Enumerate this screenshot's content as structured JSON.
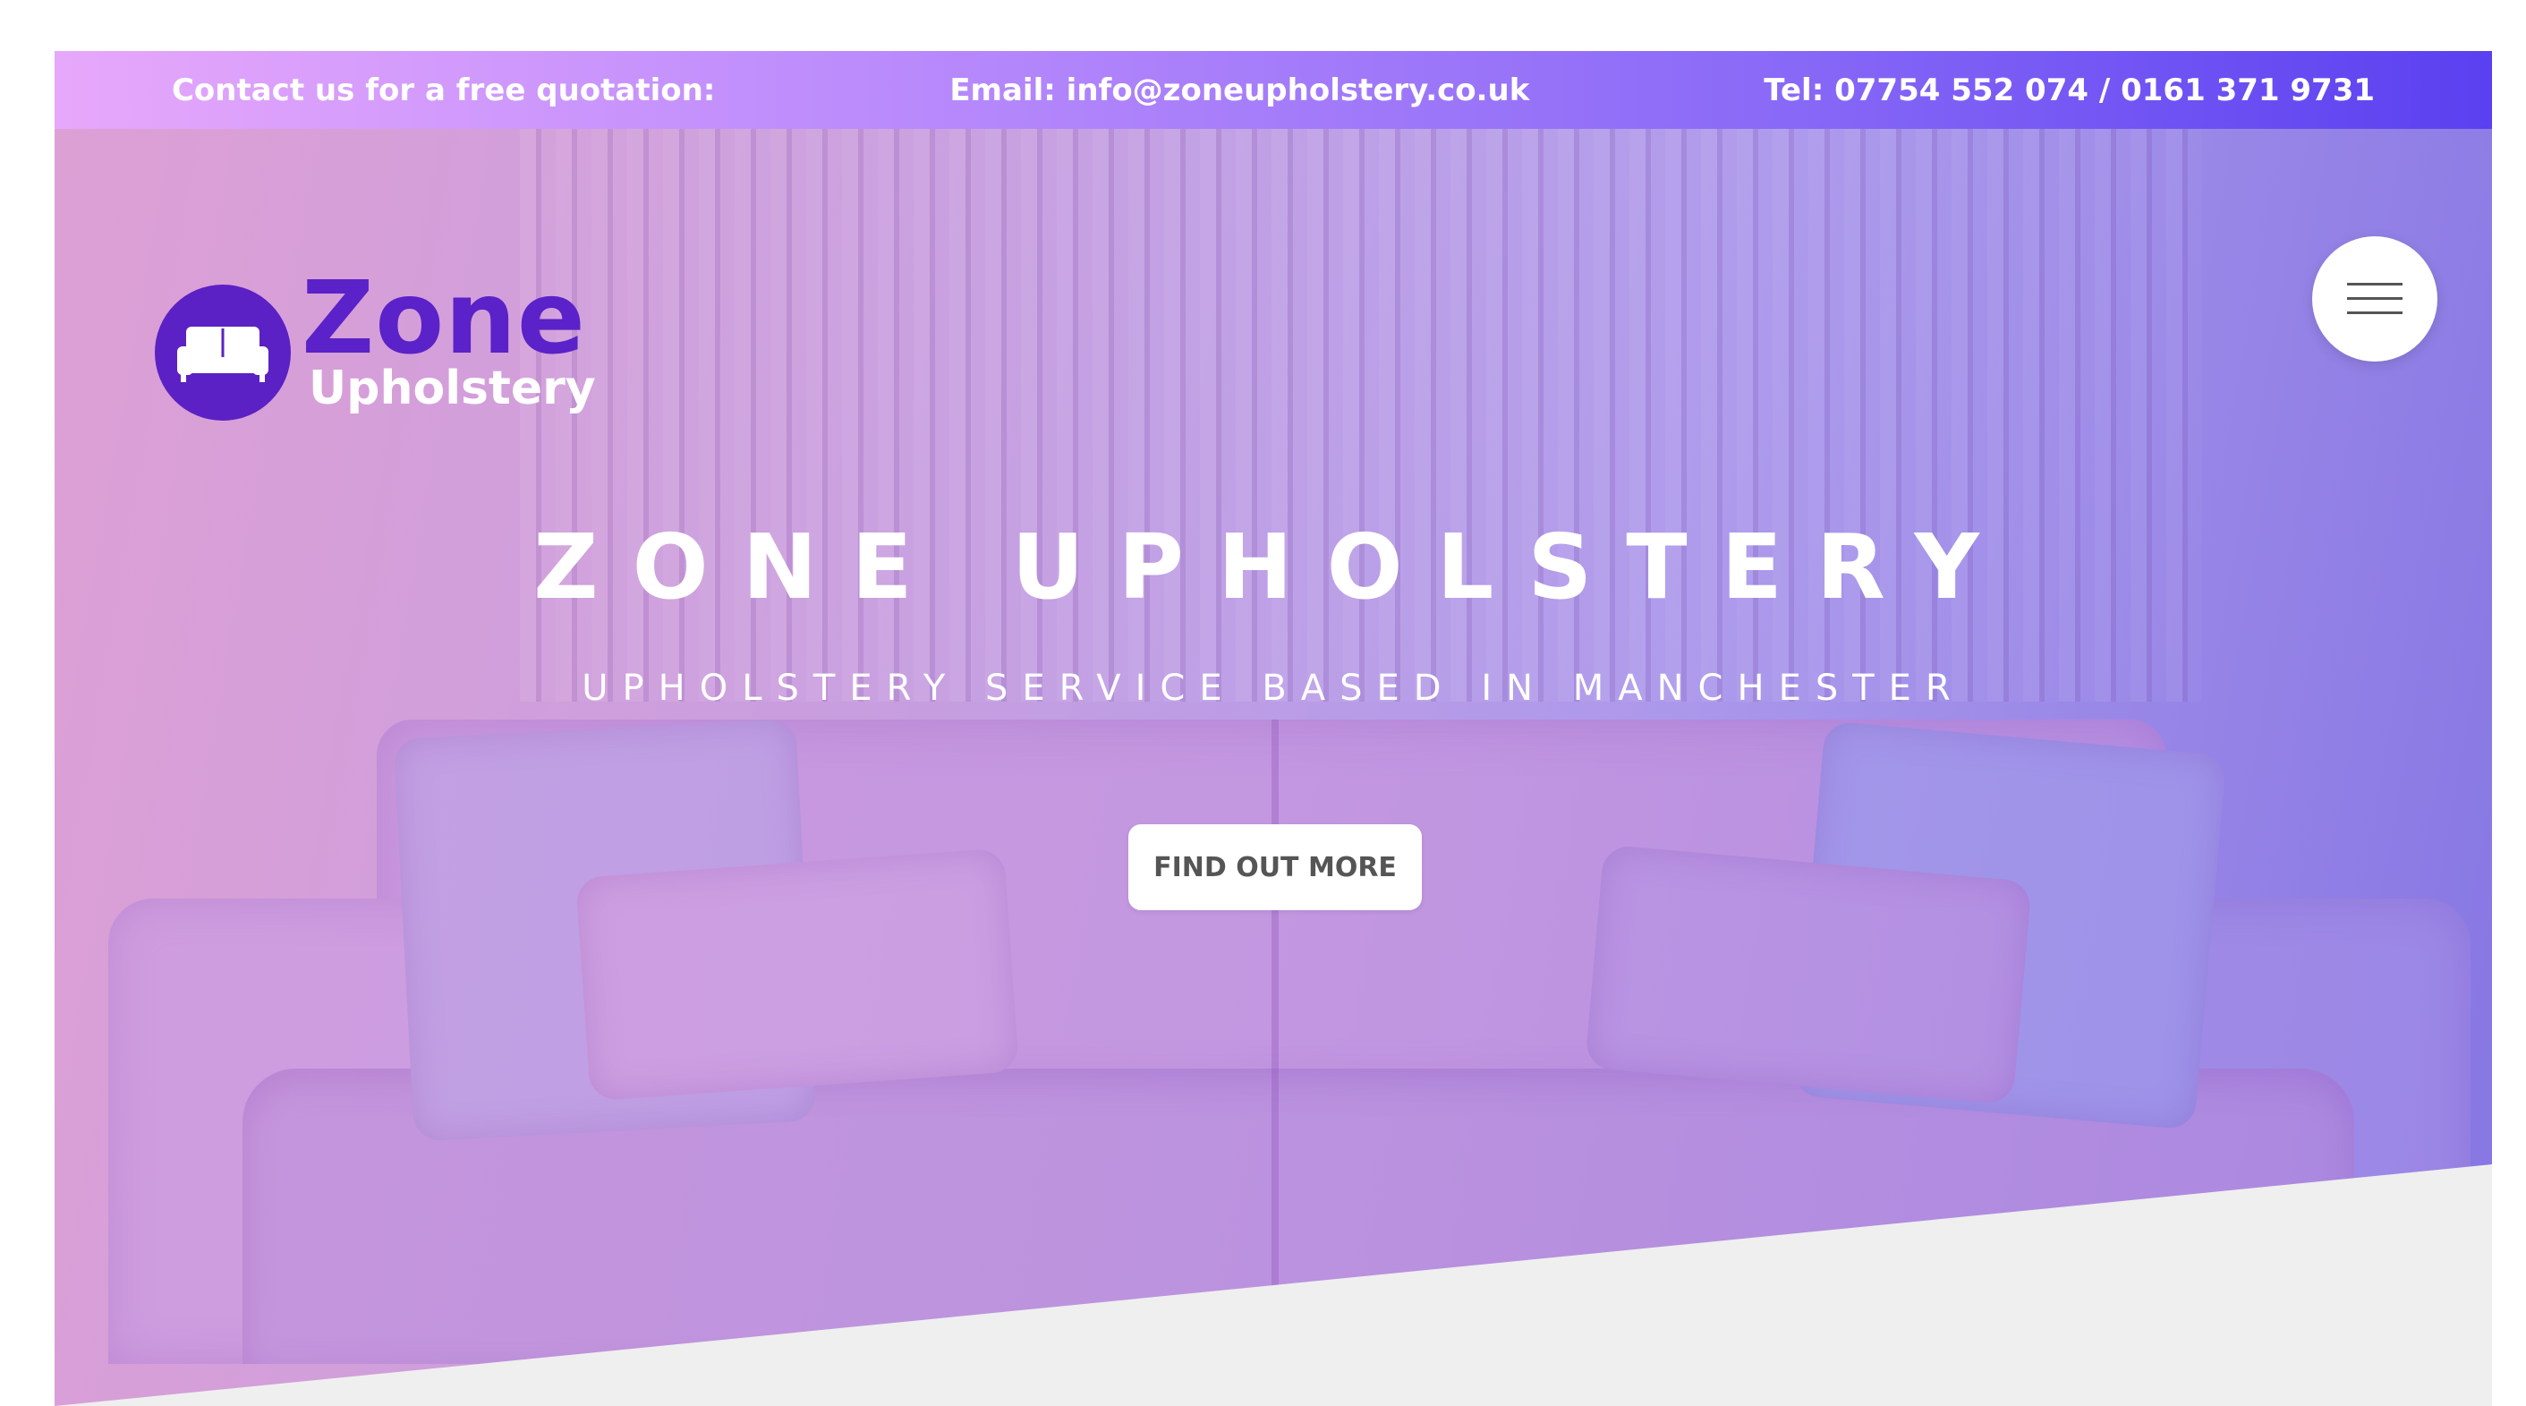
{
  "topbar": {
    "quote_text": "Contact us for a free quotation:",
    "email_text": "Email: info@zoneupholstery.co.uk",
    "tel_text": "Tel: 07754 552 074 / 0161 371 9731"
  },
  "logo": {
    "line1": "Zone",
    "line2": "Upholstery",
    "icon": "sofa-icon"
  },
  "menu": {
    "icon": "hamburger-menu-icon"
  },
  "hero": {
    "title": "ZONE UPHOLSTERY",
    "subtitle": "UPHOLSTERY SERVICE BASED IN MANCHESTER",
    "cta_label": "FIND OUT MORE"
  },
  "colors": {
    "topbar_start": "#e7a8fb",
    "topbar_end": "#5a40f0",
    "brand_purple": "#5a22c8",
    "diagonal_fill": "#efefef",
    "cta_text": "#555555"
  }
}
